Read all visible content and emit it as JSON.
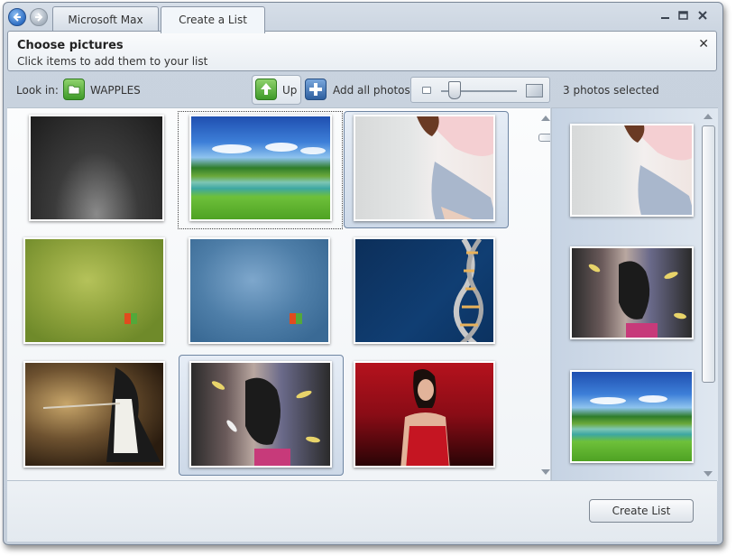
{
  "tabs": [
    {
      "label": "Microsoft Max"
    },
    {
      "label": "Create a List"
    }
  ],
  "header": {
    "title": "Choose pictures",
    "subtitle": "Click items to add them to your list"
  },
  "toolbar": {
    "look_in_label": "Look in:",
    "folder_name": "WAPPLES",
    "up_label": "Up",
    "add_all_label": "Add all photos",
    "zoom_level": 0.2,
    "selected_count_text": "3 photos selected"
  },
  "grid": {
    "items": [
      {
        "id": "dark-gradient",
        "selected": false
      },
      {
        "id": "landscape-sky",
        "selected": true
      },
      {
        "id": "girl-pink-shirt",
        "selected": true
      },
      {
        "id": "green-abstract",
        "selected": false
      },
      {
        "id": "blue-abstract",
        "selected": false
      },
      {
        "id": "dna-helix",
        "selected": false
      },
      {
        "id": "anime-swordswoman",
        "selected": false
      },
      {
        "id": "anime-feathers",
        "selected": true
      },
      {
        "id": "woman-red-dress",
        "selected": false
      }
    ]
  },
  "selected_items": [
    "girl-pink-shirt",
    "anime-feathers",
    "landscape-sky"
  ],
  "footer": {
    "create_button_label": "Create List"
  },
  "colors": {
    "accent_blue": "#2f6fc4",
    "green_icon": "#3f9a29",
    "frame_border": "#7a8696"
  },
  "icons": [
    "back-icon",
    "forward-icon",
    "minimize-icon",
    "maximize-icon",
    "close-icon",
    "folder-icon",
    "up-arrow-icon",
    "plus-icon",
    "small-thumb-icon",
    "large-thumb-icon"
  ]
}
